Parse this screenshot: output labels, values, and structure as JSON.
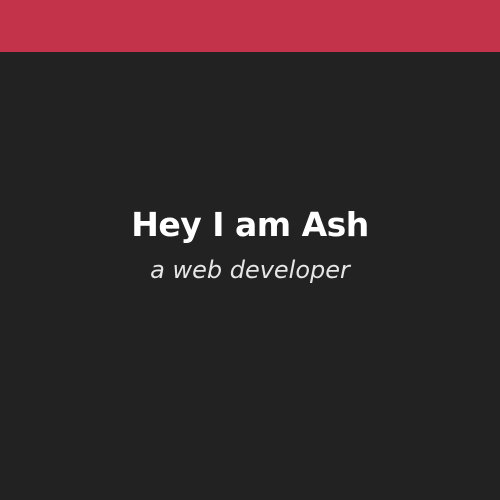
{
  "colors": {
    "accent": "#c3334a",
    "background": "#222223",
    "title_text": "#ffffff",
    "subtitle_text": "#e6e6e6"
  },
  "hero": {
    "title": "Hey I am Ash",
    "subtitle": "a web developer"
  }
}
